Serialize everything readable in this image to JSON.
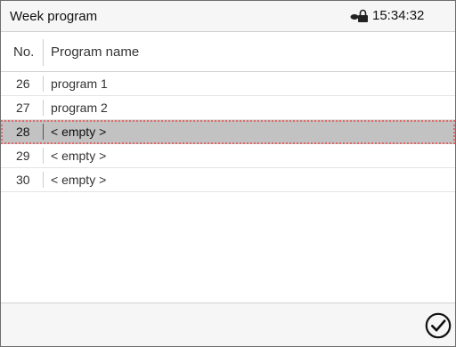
{
  "header": {
    "title": "Week program",
    "time": "15:34:32",
    "lock_icon": "lock-icon"
  },
  "table": {
    "columns": [
      "No.",
      "Program name"
    ],
    "rows": [
      {
        "no": "26",
        "name": "program 1"
      },
      {
        "no": "27",
        "name": "program 2"
      },
      {
        "no": "28",
        "name": "< empty >",
        "selected": true
      },
      {
        "no": "29",
        "name": "< empty >"
      },
      {
        "no": "30",
        "name": "< empty >"
      }
    ]
  },
  "footer": {
    "confirm_icon": "checkmark-circle-icon"
  },
  "colors": {
    "selected_row": "#c2c2c2",
    "selection_outline": "#e06a6a"
  }
}
